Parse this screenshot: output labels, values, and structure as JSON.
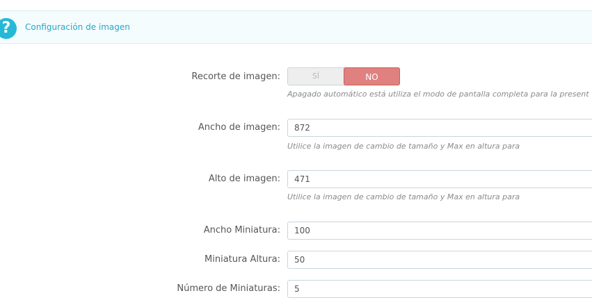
{
  "panel": {
    "title": "Configuración de imagen",
    "icon": "help-icon",
    "accent_color": "#25b9d7"
  },
  "fields": {
    "image_crop": {
      "label": "Recorte de imagen:",
      "yes_label": "SÍ",
      "no_label": "NO",
      "selected": "NO",
      "help": "Apagado automático está utiliza el modo de pantalla completa para la present"
    },
    "image_width": {
      "label": "Ancho de imagen:",
      "value": "872",
      "help": "Utilice la imagen de cambio de tamaño y Max en altura para"
    },
    "image_height": {
      "label": "Alto de imagen:",
      "value": "471",
      "help": "Utilice la imagen de cambio de tamaño y Max en altura para"
    },
    "thumb_width": {
      "label": "Ancho Miniatura:",
      "value": "100"
    },
    "thumb_height": {
      "label": "Miniatura Altura:",
      "value": "50"
    },
    "thumb_count": {
      "label": "Número de Miniaturas:",
      "value": "5"
    }
  }
}
